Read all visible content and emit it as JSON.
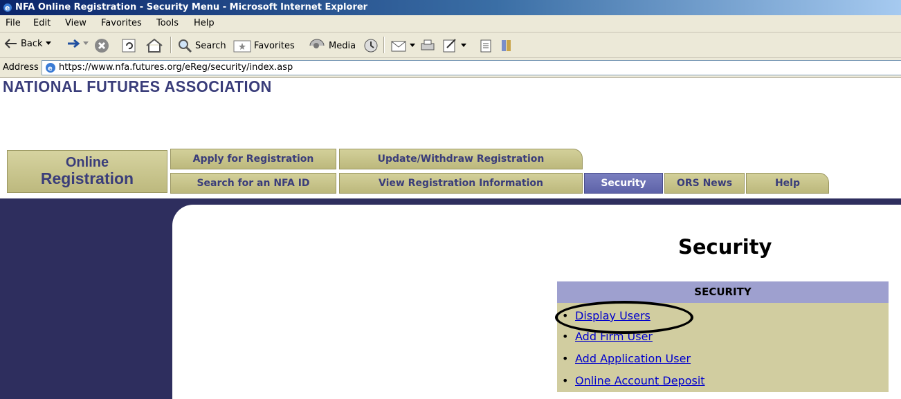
{
  "window": {
    "title": "NFA Online Registration - Security Menu - Microsoft Internet Explorer"
  },
  "menubar": {
    "items": [
      "File",
      "Edit",
      "View",
      "Favorites",
      "Tools",
      "Help"
    ]
  },
  "toolbar": {
    "back_label": "Back",
    "search_label": "Search",
    "favorites_label": "Favorites",
    "media_label": "Media"
  },
  "address": {
    "label": "Address",
    "url": "https://www.nfa.futures.org/eReg/security/index.asp"
  },
  "site": {
    "org_name": "NATIONAL FUTURES ASSOCIATION",
    "brand_line1": "Online",
    "brand_line2": "Registration"
  },
  "nav": {
    "row1": [
      "Apply for Registration",
      "Update/Withdraw Registration"
    ],
    "row2": [
      "Search for an NFA ID",
      "View Registration Information",
      "Security",
      "ORS News",
      "Help"
    ],
    "active": "Security"
  },
  "main": {
    "heading": "Security",
    "box_header": "SECURITY",
    "links": [
      "Display Users",
      "Add Firm User",
      "Add Application User",
      "Online Account Deposit"
    ]
  },
  "colors": {
    "nav_dark": "#2e2e5e",
    "tab_tan": "#c9c690",
    "tab_active": "#6469ae",
    "box_header": "#9ea0cf",
    "box_body": "#d1cda0",
    "link": "#0000cc"
  }
}
